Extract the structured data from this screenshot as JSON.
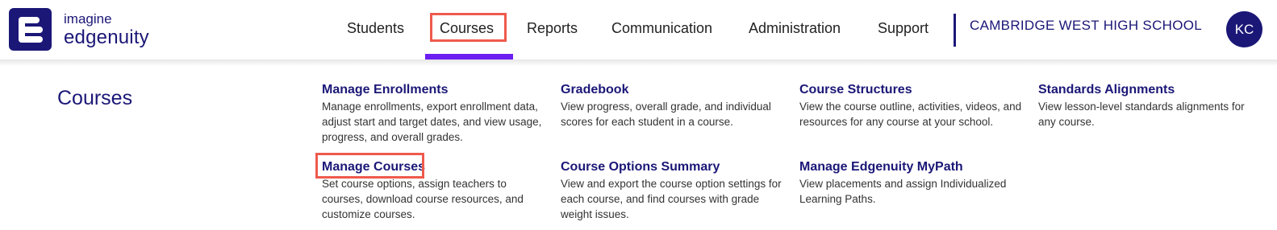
{
  "brand": {
    "line1": "imagine",
    "line2": "edgenuity"
  },
  "nav": {
    "students": "Students",
    "courses": "Courses",
    "reports": "Reports",
    "communication": "Communication",
    "administration": "Administration",
    "support": "Support",
    "active": "Courses"
  },
  "school_name": "CAMBRIDGE WEST HIGH SCHOOL",
  "user_initials": "KC",
  "panel": {
    "title": "Courses",
    "items": [
      {
        "title": "Manage Enrollments",
        "desc": "Manage enrollments, export enrollment data, adjust start and target dates, and view usage, progress, and overall grades."
      },
      {
        "title": "Gradebook",
        "desc": "View progress, overall grade, and individual scores for each student in a course."
      },
      {
        "title": "Course Structures",
        "desc": "View the course outline, activities, videos, and resources for any course at your school."
      },
      {
        "title": "Standards Alignments",
        "desc": "View lesson-level standards alignments for any course."
      },
      {
        "title": "Manage Courses",
        "desc": "Set course options, assign teachers to courses, download course resources, and customize courses."
      },
      {
        "title": "Course Options Summary",
        "desc": "View and export the course option settings for each course, and find courses with grade weight issues."
      },
      {
        "title": "Manage Edgenuity MyPath",
        "desc": "View placements and assign Individualized Learning Paths."
      }
    ]
  },
  "colors": {
    "brand": "#1b1777",
    "accent": "#6d1ff2",
    "highlight": "#ee5a4d"
  }
}
